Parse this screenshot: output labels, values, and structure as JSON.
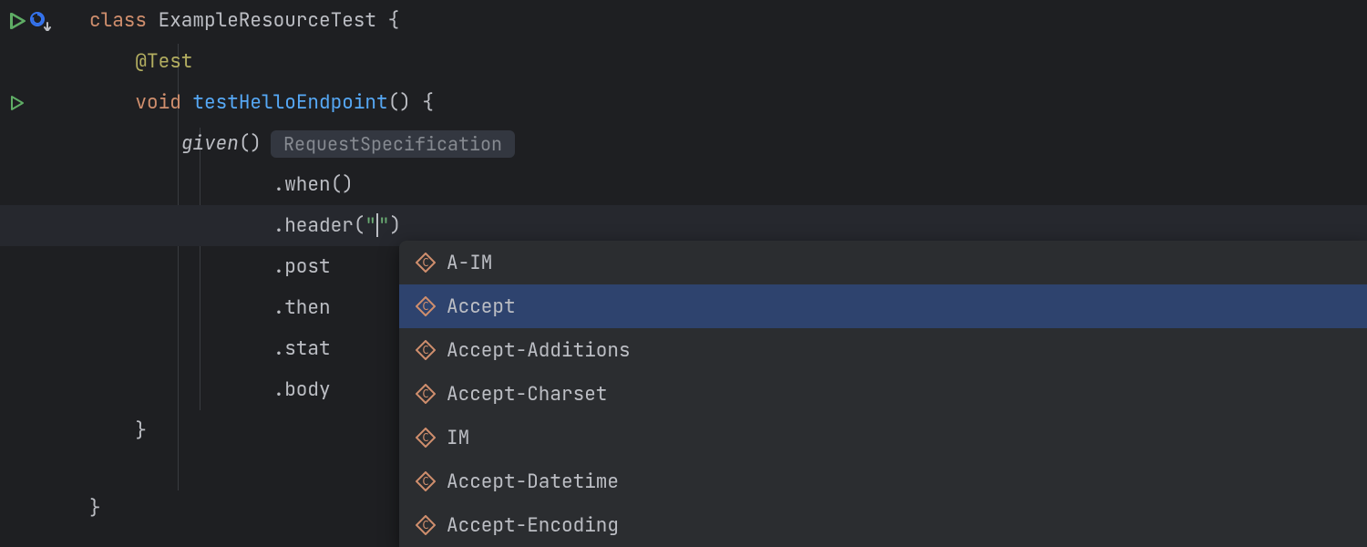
{
  "code": {
    "class_kw": "class",
    "class_name": "ExampleResourceTest",
    "open_brace": " {",
    "test_annotation": "@Test",
    "void_kw": "void",
    "method_name": "testHelloEndpoint",
    "method_sig_tail": "() {",
    "given": "given",
    "given_tail": "()",
    "inlay_type": "RequestSpecification",
    "when": ".when()",
    "header_call": ".header(",
    "header_str_open": "\"",
    "header_str_close": "\"",
    "header_close": ")",
    "post": ".post",
    "then": ".then",
    "stat": ".stat",
    "body": ".body",
    "close1": "}",
    "close2": "}"
  },
  "completion": {
    "items": [
      {
        "label": "A-IM"
      },
      {
        "label": "Accept"
      },
      {
        "label": "Accept-Additions"
      },
      {
        "label": "Accept-Charset"
      },
      {
        "label": "IM"
      },
      {
        "label": "Accept-Datetime"
      },
      {
        "label": "Accept-Encoding"
      }
    ],
    "selected_index": 1
  },
  "colors": {
    "run_green": "#5fad65",
    "refresh_blue": "#3574f0",
    "diamond_stroke": "#cf8e6d"
  }
}
